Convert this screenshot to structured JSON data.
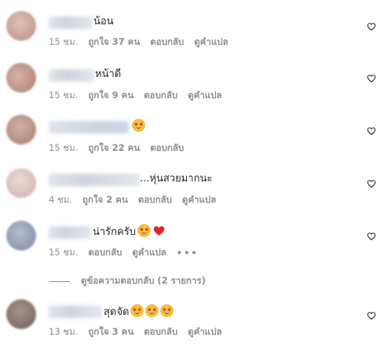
{
  "comments": [
    {
      "text": "น้อน",
      "time": "15 ชม.",
      "likes": "ถูกใจ 37 คน",
      "reply": "ตอบกลับ",
      "translate": "ดูคำแปล",
      "avatar_color": "#c9a59c",
      "emojis": []
    },
    {
      "text": "หน้าดี",
      "time": "15 ชม.",
      "likes": "ถูกใจ 9 คน",
      "reply": "ตอบกลับ",
      "translate": "ดูคำแปล",
      "avatar_color": "#b88f86",
      "emojis": []
    },
    {
      "text": "",
      "time": "15 ชม.",
      "likes": "ถูกใจ 22 คน",
      "reply": "ตอบกลับ",
      "translate": "",
      "avatar_color": "#b49388",
      "emojis": [
        "star-struck"
      ]
    },
    {
      "text": "...หุ่นสวยมากนะ",
      "time": "4 ชม.",
      "likes": "ถูกใจ 2 คน",
      "reply": "ตอบกลับ",
      "translate": "ดูคำแปล",
      "avatar_color": "#d8c3c0",
      "emojis": []
    },
    {
      "text": "น่ารักครับ",
      "time": "15 ชม.",
      "likes": "",
      "reply": "ตอบกลับ",
      "translate": "ดูคำแปล",
      "more": "•••",
      "avatar_color": "#8f98b2",
      "emojis": [
        "star-struck",
        "red-heart"
      ]
    },
    {
      "text": "สุดจัด",
      "time": "13 ชม.",
      "likes": "ถูกใจ 3 คน",
      "reply": "ตอบกลับ",
      "translate": "ดูคำแปล",
      "avatar_color": "#8a7a72",
      "emojis": [
        "star-struck",
        "star-struck",
        "star-struck"
      ]
    }
  ],
  "view_replies": "ดูข้อความตอบกลับ (2 รายการ)",
  "colors": {
    "text": "#262626",
    "meta": "#8e8e8e",
    "heart_stroke": "#262626"
  },
  "icons": {
    "like": "heart-outline-icon",
    "emoji_star": "star-struck-emoji",
    "emoji_heart": "red-heart-emoji"
  }
}
